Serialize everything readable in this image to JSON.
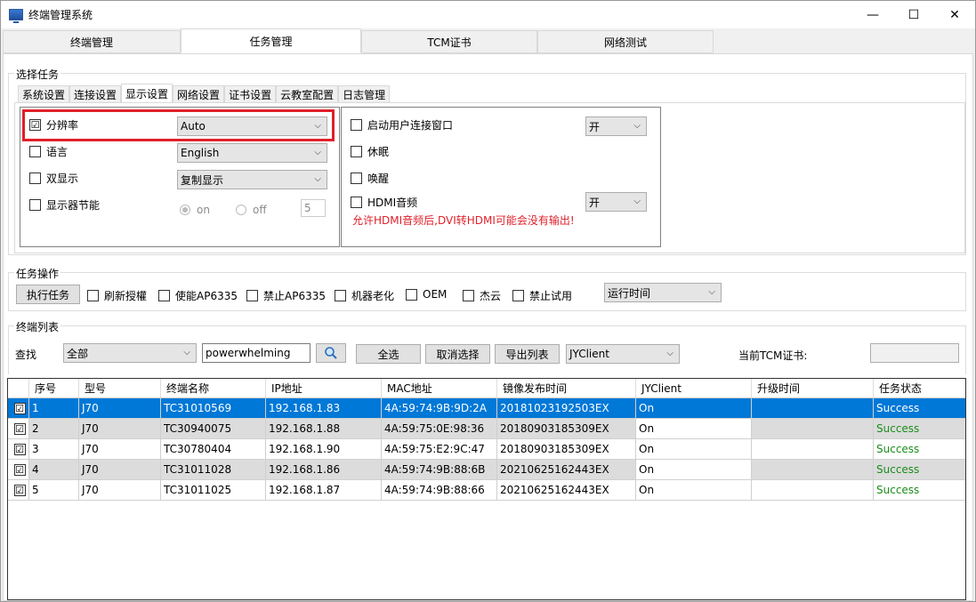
{
  "app": {
    "title": "终端管理系统"
  },
  "main_tabs": [
    {
      "label": "终端管理"
    },
    {
      "label": "任务管理"
    },
    {
      "label": "TCM证书"
    },
    {
      "label": "网络测试"
    }
  ],
  "select_task": {
    "title": "选择任务",
    "subtabs": [
      {
        "label": "系统设置"
      },
      {
        "label": "连接设置"
      },
      {
        "label": "显示设置"
      },
      {
        "label": "网络设置"
      },
      {
        "label": "证书设置"
      },
      {
        "label": "云教室配置"
      },
      {
        "label": "日志管理"
      }
    ],
    "left": {
      "resolution": {
        "label": "分辨率",
        "checked": "☑",
        "value": "Auto"
      },
      "language": {
        "label": "语言",
        "value": "English"
      },
      "dual_display": {
        "label": "双显示",
        "value": "复制显示"
      },
      "power_save": {
        "label": "显示器节能",
        "on": "on",
        "off": "off",
        "value": "5"
      }
    },
    "right": {
      "start_window": {
        "label": "启动用户连接窗口",
        "value": "开"
      },
      "sleep": {
        "label": "休眠"
      },
      "wake": {
        "label": "唤醒"
      },
      "hdmi_audio": {
        "label": "HDMI音频",
        "value": "开"
      },
      "warning": "允许HDMI音频后,DVI转HDMI可能会没有输出!"
    }
  },
  "task_ops": {
    "title": "任务操作",
    "execute": "执行任务",
    "options": [
      {
        "label": "刷新授權"
      },
      {
        "label": "使能AP6335"
      },
      {
        "label": "禁止AP6335"
      },
      {
        "label": "机器老化"
      },
      {
        "label": "OEM"
      },
      {
        "label": "杰云"
      },
      {
        "label": "禁止试用"
      }
    ],
    "run_time": "运行时间"
  },
  "terminal_list": {
    "title": "终端列表",
    "search_label": "查找",
    "filter": "全部",
    "search_value": "powerwhelming",
    "select_all": "全选",
    "deselect": "取消选择",
    "export": "导出列表",
    "client": "JYClient",
    "tcm_label": "当前TCM证书:",
    "columns": [
      "序号",
      "型号",
      "终端名称",
      "IP地址",
      "MAC地址",
      "镜像发布时间",
      "JYClient",
      "升级时间",
      "任务状态"
    ],
    "rows": [
      {
        "no": "1",
        "model": "J70",
        "name": "TC31010569",
        "ip": "192.168.1.83",
        "mac": "4A:59:74:9B:9D:2A",
        "image": "20181023192503EX",
        "client": "On",
        "upgrade": "",
        "status": "Success"
      },
      {
        "no": "2",
        "model": "J70",
        "name": "TC30940075",
        "ip": "192.168.1.88",
        "mac": "4A:59:75:0E:98:36",
        "image": "20180903185309EX",
        "client": "On",
        "upgrade": "",
        "status": "Success"
      },
      {
        "no": "3",
        "model": "J70",
        "name": "TC30780404",
        "ip": "192.168.1.90",
        "mac": "4A:59:75:E2:9C:47",
        "image": "20180903185309EX",
        "client": "On",
        "upgrade": "",
        "status": "Success"
      },
      {
        "no": "4",
        "model": "J70",
        "name": "TC31011028",
        "ip": "192.168.1.86",
        "mac": "4A:59:74:9B:88:6B",
        "image": "20210625162443EX",
        "client": "On",
        "upgrade": "",
        "status": "Success"
      },
      {
        "no": "5",
        "model": "J70",
        "name": "TC31011025",
        "ip": "192.168.1.87",
        "mac": "4A:59:74:9B:88:66",
        "image": "20210625162443EX",
        "client": "On",
        "upgrade": "",
        "status": "Success"
      }
    ],
    "check": "☑"
  },
  "colors": {
    "selection": "#0078d7",
    "highlight": "#e0202a",
    "success": "#1a8c1a"
  }
}
